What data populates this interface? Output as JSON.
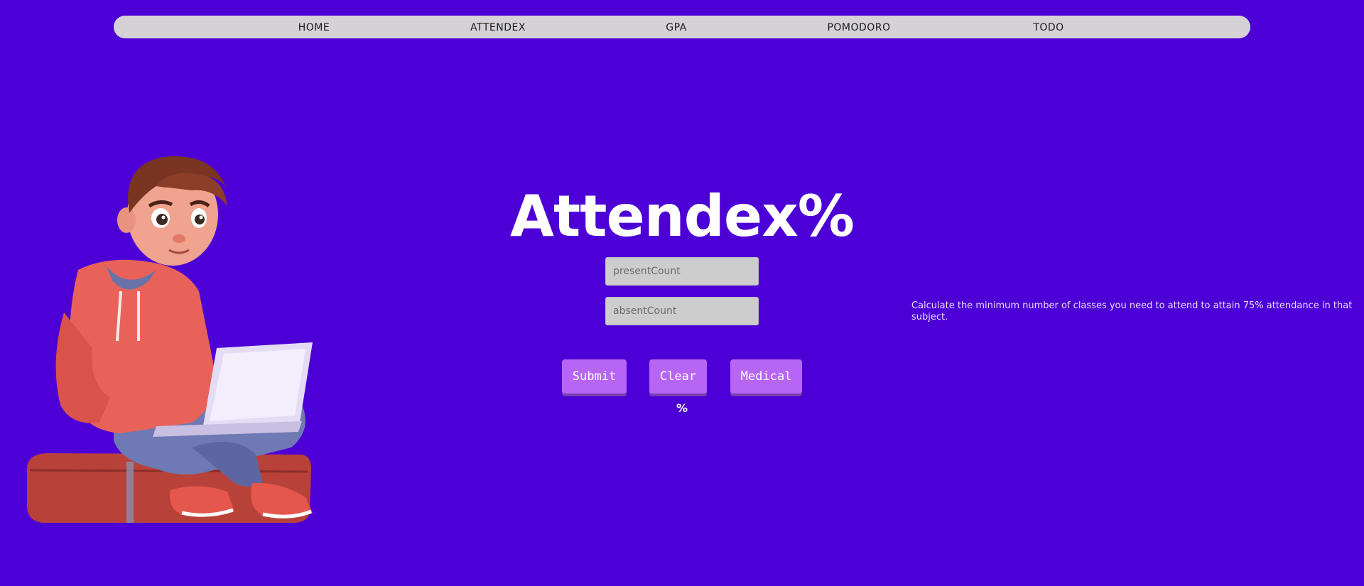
{
  "nav": {
    "items": [
      {
        "label": "HOME"
      },
      {
        "label": "ATTENDEX"
      },
      {
        "label": "GPA"
      },
      {
        "label": "POMODORO"
      },
      {
        "label": "TODO"
      }
    ]
  },
  "main": {
    "title": "Attendex%",
    "present_placeholder": "presentCount",
    "absent_placeholder": "absentCount",
    "submit_label": "Submit",
    "clear_label": "Clear",
    "medical_label": "Medical",
    "result_text": "%"
  },
  "info": {
    "text": "Calculate the minimum number of classes you need to attend to attain 75% attendance in that subject."
  },
  "colors": {
    "background": "#4d00d6",
    "navbar": "#d4d2d6",
    "button": "#b765f5",
    "input": "#cdcdcd"
  },
  "illustration": {
    "icon": "student-with-laptop-illustration"
  }
}
